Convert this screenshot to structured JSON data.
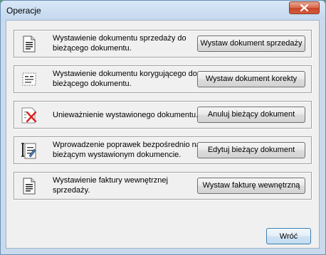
{
  "window": {
    "title": "Operacje"
  },
  "operations": [
    {
      "description": "Wystawienie dokumentu sprzedaży do bieżącego dokumentu.",
      "button": "Wystaw dokument sprzedaży",
      "icon": "document-icon"
    },
    {
      "description": "Wystawienie dokumentu korygującego do bieżącego dokumentu.",
      "button": "Wystaw dokument korekty",
      "icon": "correction-document-icon"
    },
    {
      "description": "Unieważnienie wystawionego dokumentu.",
      "button": "Anuluj bieżący dokument",
      "icon": "cancel-document-icon"
    },
    {
      "description": "Wprowadzenie poprawek bezpośrednio na bieżącym wystawionym dokumencie.",
      "button": "Edytuj bieżący dokument",
      "icon": "edit-document-icon"
    },
    {
      "description": "Wystawienie faktury wewnętrznej sprzedaży.",
      "button": "Wystaw fakturę wewnętrzną",
      "icon": "document-icon"
    }
  ],
  "footer": {
    "back_label": "Wróć"
  }
}
